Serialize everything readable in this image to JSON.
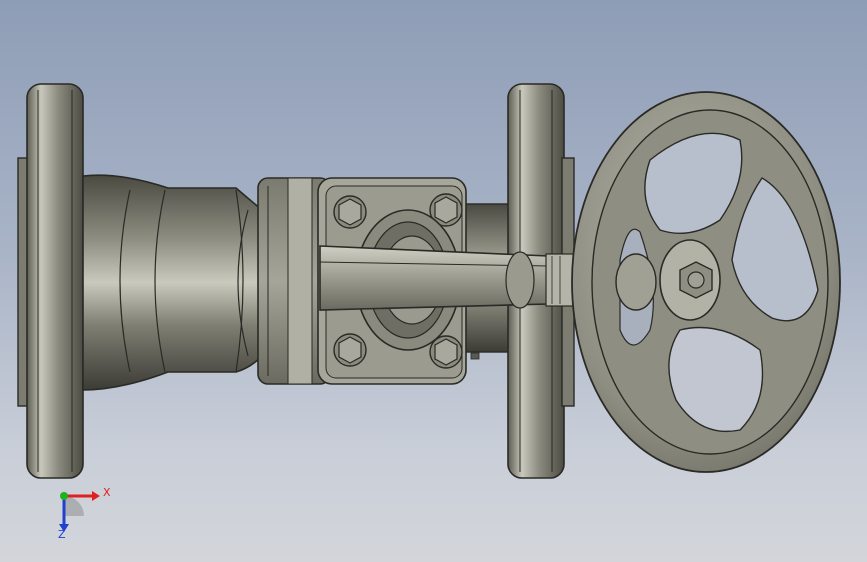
{
  "viewport": {
    "background_top": "#8e9db6",
    "background_bottom": "#d3d5da"
  },
  "model": {
    "part_color": "#9a9a8c",
    "edge_color": "#2a2a26",
    "highlight_color": "#e6e6dc"
  },
  "triad": {
    "x_label": "X",
    "z_label": "Z",
    "x_color": "#e02020",
    "y_color": "#20b020",
    "z_color": "#2040d0"
  }
}
